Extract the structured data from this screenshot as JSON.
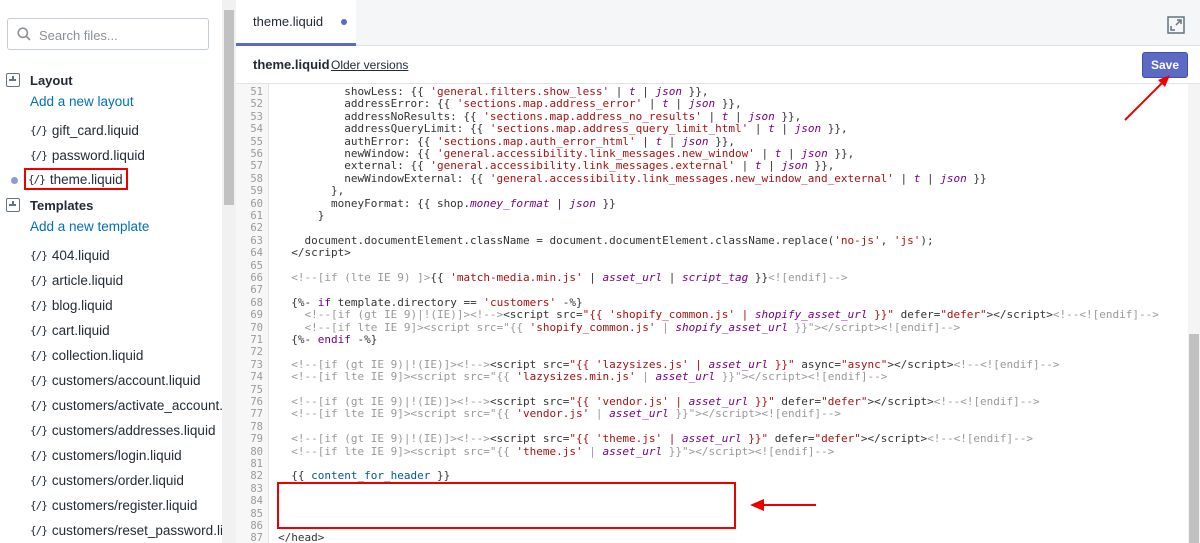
{
  "sidebar": {
    "search": {
      "placeholder": "Search files...",
      "value": ""
    },
    "sections": [
      {
        "title": "Layout",
        "add_label": "Add a new layout",
        "files": [
          {
            "name": "gift_card.liquid",
            "active": false
          },
          {
            "name": "password.liquid",
            "active": false
          },
          {
            "name": "theme.liquid",
            "active": true
          }
        ]
      },
      {
        "title": "Templates",
        "add_label": "Add a new template",
        "files": [
          {
            "name": "404.liquid",
            "active": false
          },
          {
            "name": "article.liquid",
            "active": false
          },
          {
            "name": "blog.liquid",
            "active": false
          },
          {
            "name": "cart.liquid",
            "active": false
          },
          {
            "name": "collection.liquid",
            "active": false
          },
          {
            "name": "customers/account.liquid",
            "active": false
          },
          {
            "name": "customers/activate_account.liquid",
            "active": false
          },
          {
            "name": "customers/addresses.liquid",
            "active": false
          },
          {
            "name": "customers/login.liquid",
            "active": false
          },
          {
            "name": "customers/order.liquid",
            "active": false
          },
          {
            "name": "customers/register.liquid",
            "active": false
          },
          {
            "name": "customers/reset_password.liquid",
            "active": false
          }
        ]
      }
    ],
    "file_icon": "{/}"
  },
  "editor": {
    "tab_label": "theme.liquid",
    "file_title": "theme.liquid",
    "older_versions": "Older versions",
    "save_label": "Save",
    "accent": "#5c6ac4",
    "lines": [
      {
        "n": "51",
        "html": "          showLess: {{ <span class=\"s\">'general.filters.show_less'</span> | <span class=\"f\">t</span> | <span class=\"f\">json</span> }},"
      },
      {
        "n": "52",
        "html": "          addressError: {{ <span class=\"s\">'sections.map.address_error'</span> | <span class=\"f\">t</span> | <span class=\"f\">json</span> }},"
      },
      {
        "n": "53",
        "html": "          addressNoResults: {{ <span class=\"s\">'sections.map.address_no_results'</span> | <span class=\"f\">t</span> | <span class=\"f\">json</span> }},"
      },
      {
        "n": "54",
        "html": "          addressQueryLimit: {{ <span class=\"s\">'sections.map.address_query_limit_html'</span> | <span class=\"f\">t</span> | <span class=\"f\">json</span> }},"
      },
      {
        "n": "55",
        "html": "          authError: {{ <span class=\"s\">'sections.map.auth_error_html'</span> | <span class=\"f\">t</span> | <span class=\"f\">json</span> }},"
      },
      {
        "n": "56",
        "html": "          newWindow: {{ <span class=\"s\">'general.accessibility.link_messages.new_window'</span> | <span class=\"f\">t</span> | <span class=\"f\">json</span> }},"
      },
      {
        "n": "57",
        "html": "          external: {{ <span class=\"s\">'general.accessibility.link_messages.external'</span> | <span class=\"f\">t</span> | <span class=\"f\">json</span> }},"
      },
      {
        "n": "58",
        "html": "          newWindowExternal: {{ <span class=\"s\">'general.accessibility.link_messages.new_window_and_external'</span> | <span class=\"f\">t</span> | <span class=\"f\">json</span> }}"
      },
      {
        "n": "59",
        "html": "        },"
      },
      {
        "n": "60",
        "html": "        moneyFormat: {{ shop.<span class=\"f\">money_format</span> | <span class=\"f\">json</span> }}"
      },
      {
        "n": "61",
        "html": "      }"
      },
      {
        "n": "62",
        "html": ""
      },
      {
        "n": "63",
        "html": "    document.documentElement.className = document.documentElement.className.replace(<span class=\"s\">'no-js'</span>, <span class=\"s\">'js'</span>);"
      },
      {
        "n": "64",
        "html": "  &lt;/script&gt;"
      },
      {
        "n": "65",
        "html": ""
      },
      {
        "n": "66",
        "html": "  <span class=\"c\">&lt;!--[if (lte IE 9) ]&gt;</span>{{ <span class=\"s\">'match-media.min.js'</span> | <span class=\"f\">asset_url</span> | <span class=\"f\">script_tag</span> }}<span class=\"c\">&lt;![endif]--&gt;</span>"
      },
      {
        "n": "67",
        "html": ""
      },
      {
        "n": "68",
        "html": "  {%- <span class=\"k\">if</span> template.directory == <span class=\"s\">'customers'</span> -%}"
      },
      {
        "n": "69",
        "html": "    <span class=\"c\">&lt;!--[if (gt IE 9)|!(IE)]&gt;&lt;!--&gt;</span>&lt;script src=<span class=\"s\">\"{{ 'shopify_common.js' | </span><span class=\"f\">shopify_asset_url</span><span class=\"s\"> }}\"</span> defer=<span class=\"s\">\"defer\"</span>&gt;&lt;/script&gt;<span class=\"c\">&lt;!--&lt;![endif]--&gt;</span>"
      },
      {
        "n": "70",
        "html": "    <span class=\"c\">&lt;!--[if lte IE 9]&gt;&lt;script src=\"{{ </span><span class=\"s\">'shopify_common.js'</span><span class=\"c\"> | </span><span class=\"f\">shopify_asset_url</span><span class=\"c\"> }}\"&gt;&lt;/script&gt;&lt;![endif]--&gt;</span>"
      },
      {
        "n": "71",
        "html": "  {%- <span class=\"k\">endif</span> -%}"
      },
      {
        "n": "72",
        "html": ""
      },
      {
        "n": "73",
        "html": "  <span class=\"c\">&lt;!--[if (gt IE 9)|!(IE)]&gt;&lt;!--&gt;</span>&lt;script src=<span class=\"s\">\"{{ 'lazysizes.js' | </span><span class=\"f\">asset_url</span><span class=\"s\"> }}\"</span> async=<span class=\"s\">\"async\"</span>&gt;&lt;/script&gt;<span class=\"c\">&lt;!--&lt;![endif]--&gt;</span>"
      },
      {
        "n": "74",
        "html": "  <span class=\"c\">&lt;!--[if lte IE 9]&gt;&lt;script src=\"{{ </span><span class=\"s\">'lazysizes.min.js'</span><span class=\"c\"> | </span><span class=\"f\">asset_url</span><span class=\"c\"> }}\"&gt;&lt;/script&gt;&lt;![endif]--&gt;</span>"
      },
      {
        "n": "75",
        "html": ""
      },
      {
        "n": "76",
        "html": "  <span class=\"c\">&lt;!--[if (gt IE 9)|!(IE)]&gt;&lt;!--&gt;</span>&lt;script src=<span class=\"s\">\"{{ 'vendor.js' | </span><span class=\"f\">asset_url</span><span class=\"s\"> }}\"</span> defer=<span class=\"s\">\"defer\"</span>&gt;&lt;/script&gt;<span class=\"c\">&lt;!--&lt;![endif]--&gt;</span>"
      },
      {
        "n": "77",
        "html": "  <span class=\"c\">&lt;!--[if lte IE 9]&gt;&lt;script src=\"{{ </span><span class=\"s\">'vendor.js'</span><span class=\"c\"> | </span><span class=\"f\">asset_url</span><span class=\"c\"> }}\"&gt;&lt;/script&gt;&lt;![endif]--&gt;</span>"
      },
      {
        "n": "78",
        "html": ""
      },
      {
        "n": "79",
        "html": "  <span class=\"c\">&lt;!--[if (gt IE 9)|!(IE)]&gt;&lt;!--&gt;</span>&lt;script src=<span class=\"s\">\"{{ 'theme.js' | </span><span class=\"f\">asset_url</span><span class=\"s\"> }}\"</span> defer=<span class=\"s\">\"defer\"</span>&gt;&lt;/script&gt;<span class=\"c\">&lt;!--&lt;![endif]--&gt;</span>"
      },
      {
        "n": "80",
        "html": "  <span class=\"c\">&lt;!--[if lte IE 9]&gt;&lt;script src=\"{{ </span><span class=\"s\">'theme.js'</span><span class=\"c\"> | </span><span class=\"f\">asset_url</span><span class=\"c\"> }}\"&gt;&lt;/script&gt;&lt;![endif]--&gt;</span>"
      },
      {
        "n": "81",
        "html": ""
      },
      {
        "n": "82",
        "html": "  {{ <span class=\"v\">content_for_header</span> }}"
      },
      {
        "n": "83",
        "html": ""
      },
      {
        "n": "84",
        "html": ""
      },
      {
        "n": "85",
        "html": ""
      },
      {
        "n": "86",
        "html": ""
      },
      {
        "n": "87",
        "html": "&lt;/head&gt;"
      }
    ]
  },
  "annotation_color": "#e00000"
}
